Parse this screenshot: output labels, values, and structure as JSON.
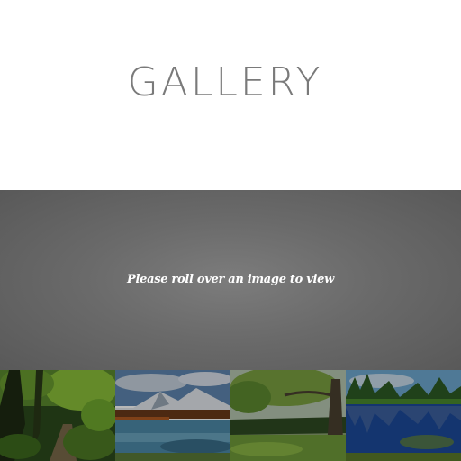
{
  "header": {
    "title": "GALLERY"
  },
  "viewer": {
    "prompt": "Please roll over an image to view"
  },
  "thumbnails": [
    {
      "subject": "forest-path"
    },
    {
      "subject": "mountain-lake"
    },
    {
      "subject": "tree-meadow"
    },
    {
      "subject": "reflection-lake"
    }
  ],
  "colors": {
    "title": "#7a7a7a",
    "viewer_bg": "#6a6a6a",
    "prompt_text": "#ffffff"
  }
}
